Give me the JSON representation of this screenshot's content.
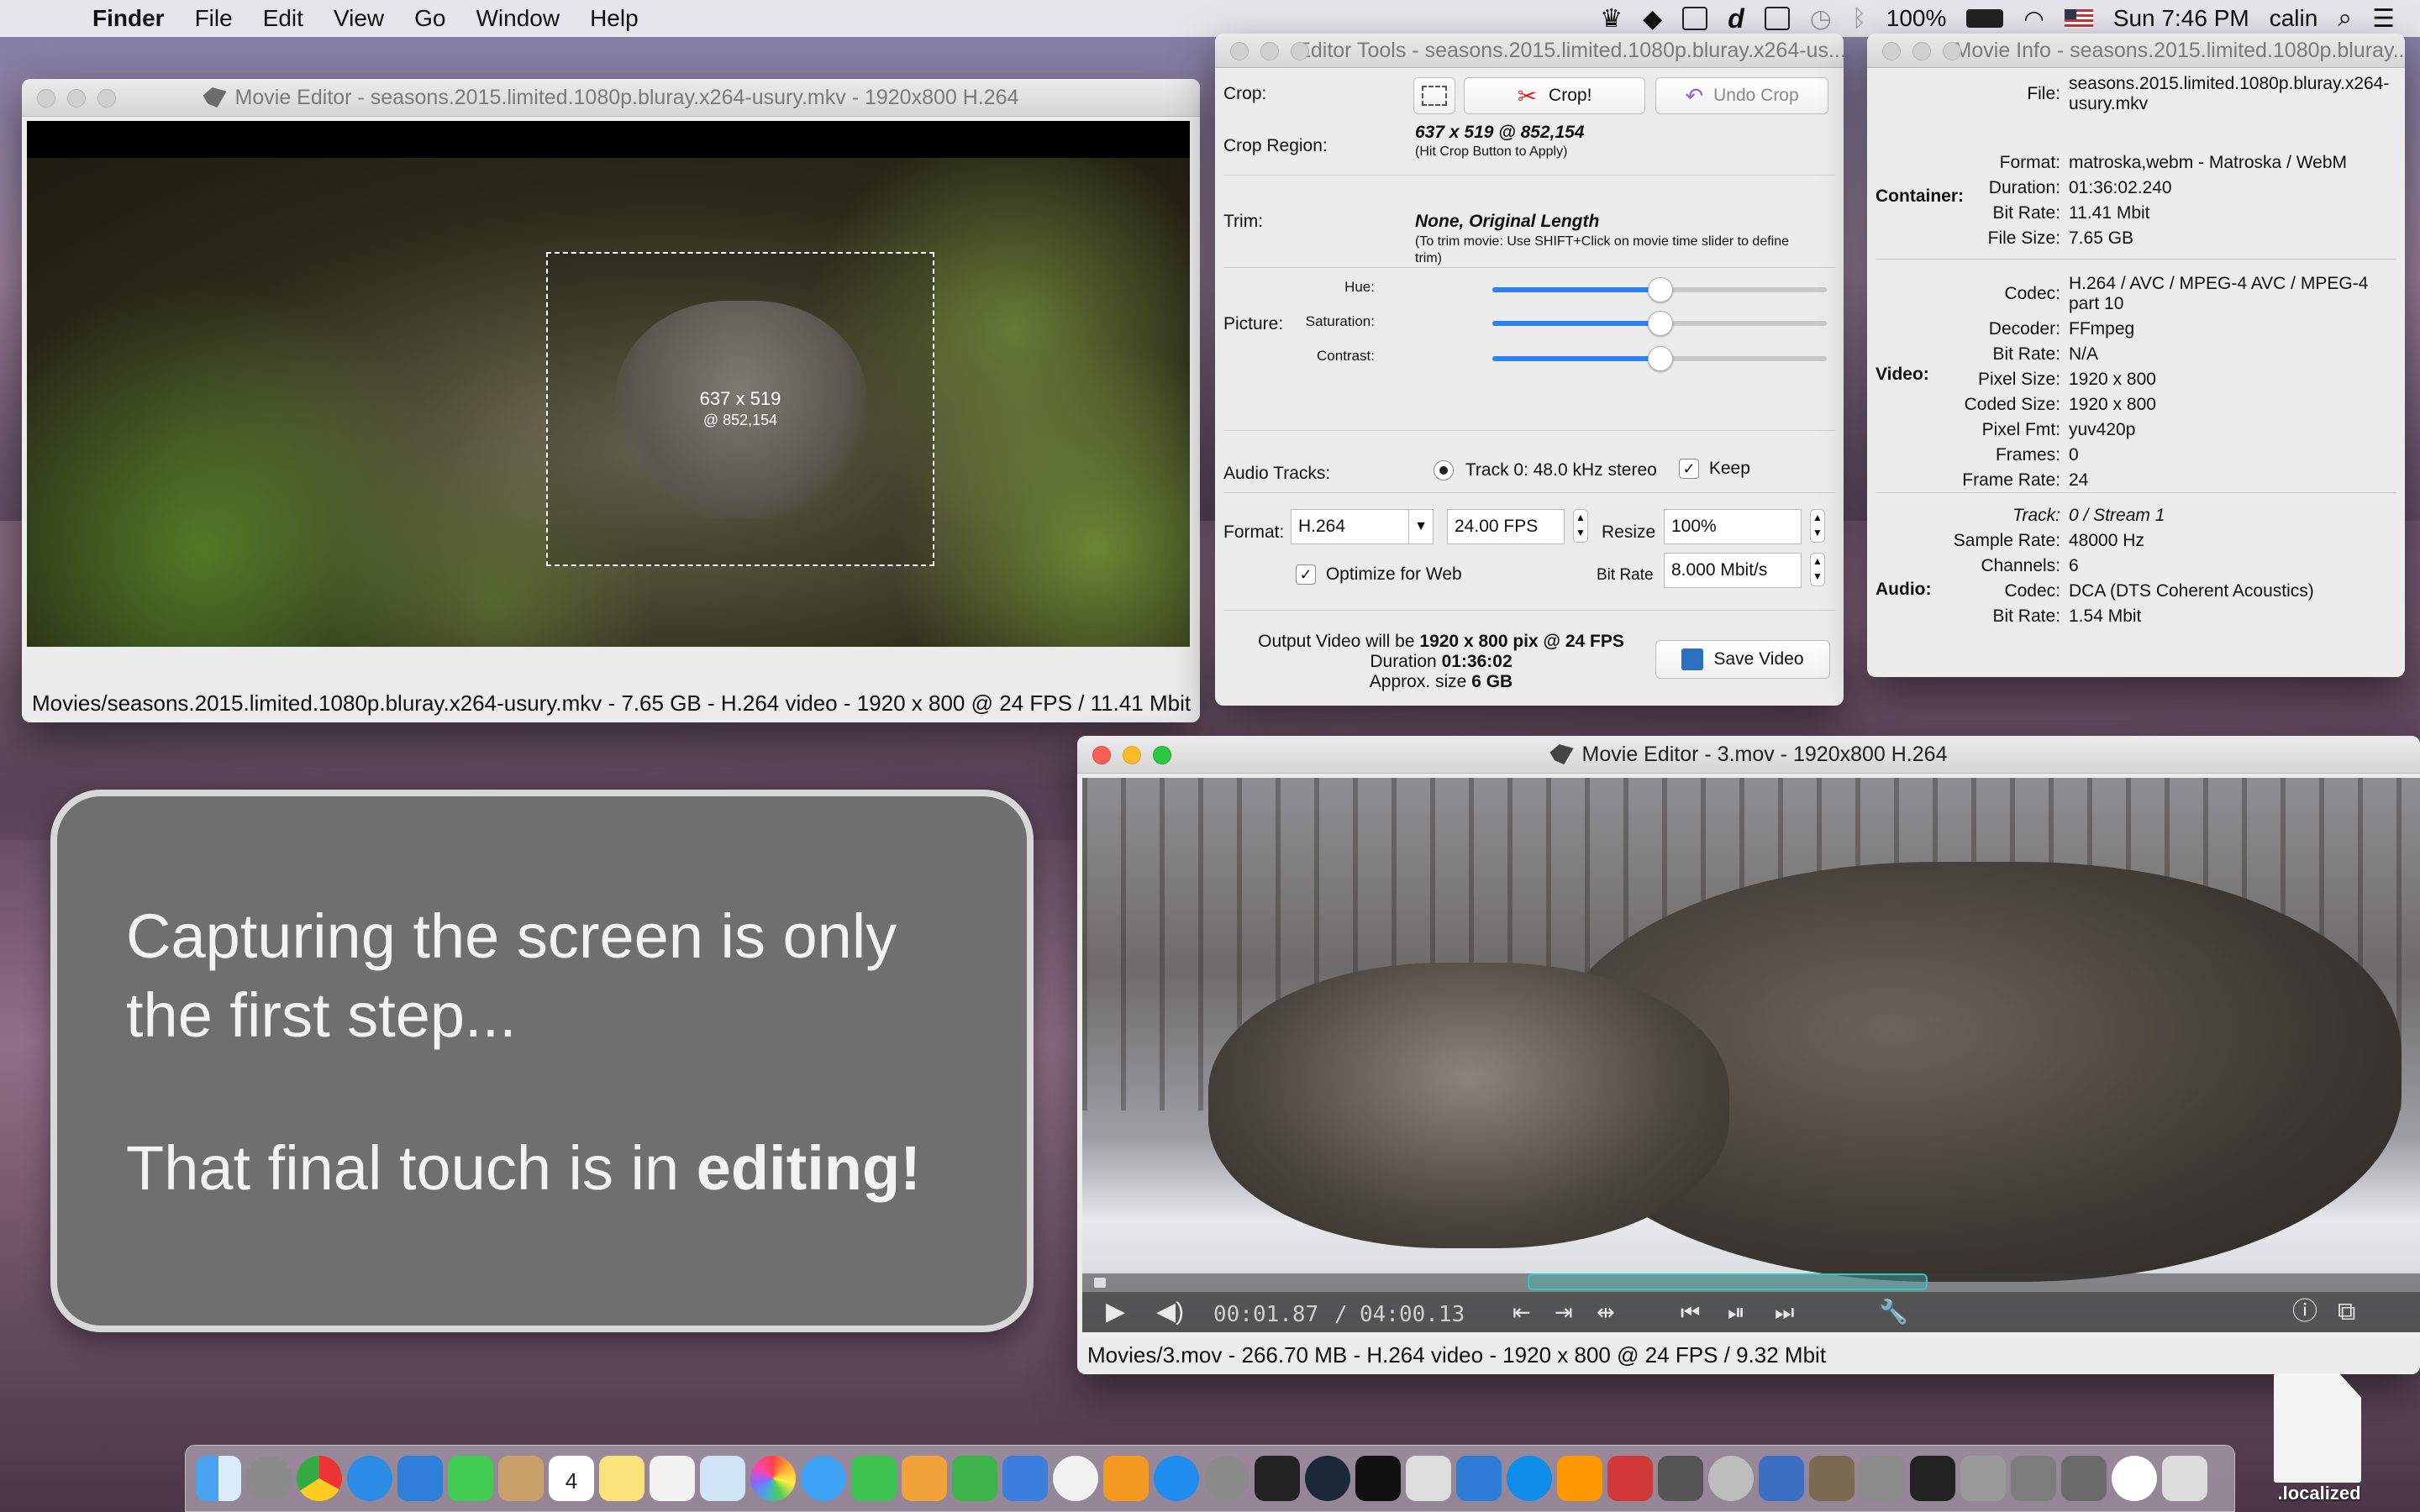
{
  "menubar": {
    "app": "Finder",
    "items": [
      "File",
      "Edit",
      "View",
      "Go",
      "Window",
      "Help"
    ],
    "battery": "100%",
    "clock": "Sun 7:46 PM",
    "user": "calin"
  },
  "editor1": {
    "title": "Movie Editor - seasons.2015.limited.1080p.bluray.x264-usury.mkv - 1920x800 H.264",
    "crop_size": "637 x 519",
    "crop_pos": "@ 852,154",
    "status": "Movies/seasons.2015.limited.1080p.bluray.x264-usury.mkv - 7.65 GB - H.264 video - 1920 x 800 @ 24 FPS / 11.41 Mbit"
  },
  "tools": {
    "title": "Editor Tools - seasons.2015.limited.1080p.bluray.x264-us...",
    "crop_label": "Crop:",
    "crop_button": "Crop!",
    "undo_crop": "Undo Crop",
    "crop_region_label": "Crop Region:",
    "crop_region_value": "637 x 519 @ 852,154",
    "crop_region_hint": "(Hit Crop Button to Apply)",
    "trim_label": "Trim:",
    "trim_value": "None, Original Length",
    "trim_hint": "(To trim movie: Use SHIFT+Click on movie time slider to define trim)",
    "picture_label": "Picture:",
    "hue_label": "Hue:",
    "saturation_label": "Saturation:",
    "contrast_label": "Contrast:",
    "hue": 0.5,
    "saturation": 0.5,
    "contrast": 0.5,
    "audio_label": "Audio Tracks:",
    "audio_track": "Track 0: 48.0 kHz stereo",
    "keep_label": "Keep",
    "format_label": "Format:",
    "format_value": "H.264",
    "fps_value": "24.00 FPS",
    "resize_label": "Resize",
    "resize_value": "100%",
    "optimize_label": "Optimize for Web",
    "bitrate_label": "Bit Rate",
    "bitrate_value": "8.000 Mbit/s",
    "output_prefix": "Output Video will be",
    "output_value": "1920 x 800 pix @ 24 FPS",
    "duration_prefix": "Duration",
    "duration_value": "01:36:02",
    "approx_prefix": "Approx. size",
    "approx_value": "6 GB",
    "save_button": "Save Video"
  },
  "info": {
    "title": "Movie Info - seasons.2015.limited.1080p.bluray...",
    "file_label": "File:",
    "file_value": "seasons.2015.limited.1080p.bluray.x264-usury.mkv",
    "container_group": "Container:",
    "container": [
      {
        "k": "Format:",
        "v": "matroska,webm - Matroska / WebM"
      },
      {
        "k": "Duration:",
        "v": "01:36:02.240"
      },
      {
        "k": "Bit Rate:",
        "v": "11.41 Mbit"
      },
      {
        "k": "File Size:",
        "v": "7.65 GB"
      }
    ],
    "video_group": "Video:",
    "codec_label": "Codec:",
    "codec_value": "H.264 / AVC / MPEG-4 AVC / MPEG-4 part 10",
    "video": [
      {
        "k": "Decoder:",
        "v": "FFmpeg"
      },
      {
        "k": "Bit Rate:",
        "v": "N/A"
      },
      {
        "k": "Pixel Size:",
        "v": "1920 x 800"
      },
      {
        "k": "Coded Size:",
        "v": "1920 x 800"
      },
      {
        "k": "Pixel Fmt:",
        "v": "yuv420p"
      },
      {
        "k": "Frames:",
        "v": "0"
      },
      {
        "k": "Frame Rate:",
        "v": "24"
      }
    ],
    "audio_group": "Audio:",
    "audio": [
      {
        "k": "Track:",
        "v": "0 / Stream 1"
      },
      {
        "k": "Sample Rate:",
        "v": "48000 Hz"
      },
      {
        "k": "Channels:",
        "v": "6"
      },
      {
        "k": "Codec:",
        "v": "DCA (DTS Coherent Acoustics)"
      },
      {
        "k": "Bit Rate:",
        "v": "1.54 Mbit"
      }
    ]
  },
  "callout": {
    "line1": "Capturing the screen is only",
    "line2": "the first step...",
    "line3_prefix": "That final touch is in ",
    "line3_bold": "editing!"
  },
  "editor2": {
    "title": "Movie Editor - 3.mov - 1920x800 H.264",
    "time_current": "00:01.87",
    "time_total": "04:00.13",
    "status": "Movies/3.mov - 266.70 MB - H.264 video - 1920 x 800 @ 24 FPS / 9.32 Mbit"
  },
  "desktop": {
    "file_label": ".localized"
  },
  "dock": {
    "calendar_day": "4"
  }
}
